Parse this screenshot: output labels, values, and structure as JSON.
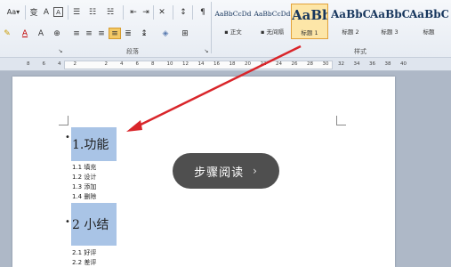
{
  "ribbon": {
    "font_size_button": "Aa▾",
    "paragraph_label": "段落",
    "styles_label": "样式",
    "styles": [
      {
        "sample": "AaBbCcDd",
        "label": "▪ 正文"
      },
      {
        "sample": "AaBbCcDd",
        "label": "▪ 无间隔"
      },
      {
        "sample": "AaBb",
        "label": "标题 1"
      },
      {
        "sample": "AaBbC",
        "label": "标题 2"
      },
      {
        "sample": "AaBbC",
        "label": "标题 3"
      },
      {
        "sample": "AaBbC",
        "label": "标题"
      }
    ]
  },
  "ruler": {
    "numbers": [
      "8",
      "6",
      "4",
      "2",
      "",
      "2",
      "4",
      "6",
      "8",
      "10",
      "12",
      "14",
      "16",
      "18",
      "20",
      "22",
      "24",
      "26",
      "28",
      "30",
      "32",
      "34",
      "36",
      "38",
      "40"
    ]
  },
  "document": {
    "heading1": "1.功能",
    "items1": [
      "1.1 填充",
      "1.2 设计",
      "1.3 添加",
      "1.4 删除"
    ],
    "heading2": "2 小结",
    "items2": [
      "2.1 好评",
      "2.2 差评"
    ]
  },
  "overlay": {
    "text": "步骤阅读",
    "chevron": "›"
  },
  "colors": {
    "heading_highlight": "#a9c4e6",
    "arrow": "#d9252a",
    "selected_style": "#fde6a8"
  }
}
